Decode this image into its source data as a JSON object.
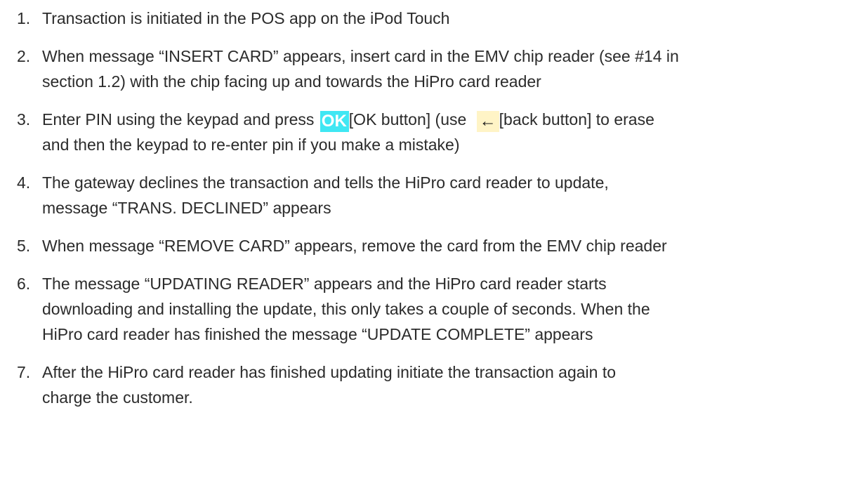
{
  "steps": [
    {
      "number": "1.",
      "text": "Transaction is initiated in the POS app on the iPod Touch"
    },
    {
      "number": "2.",
      "line1": "When message “INSERT CARD” appears, insert card in the EMV chip reader (see #14 in",
      "line2": "section 1.2)  with the chip facing up and towards the HiPro card reader"
    },
    {
      "number": "3.",
      "prefix": "Enter PIN using the keypad and press",
      "ok_glyph": "OK",
      "mid": "[OK button] (use",
      "back_glyph": "←",
      "suffix": "[back button] to erase",
      "line2": "and then the keypad to re-enter pin if you make a mistake)"
    },
    {
      "number": "4.",
      "line1": "The gateway declines the transaction and tells the HiPro card reader to update,",
      "line2": "message “TRANS. DECLINED” appears"
    },
    {
      "number": "5.",
      "text": "When message “REMOVE CARD” appears, remove the card from the EMV chip reader"
    },
    {
      "number": "6.",
      "line1": "The message “UPDATING READER” appears and the HiPro card reader starts",
      "line2": "downloading and installing the update, this only takes a couple of seconds. When the",
      "line3": "HiPro card reader has finished the message “UPDATE COMPLETE” appears"
    },
    {
      "number": "7.",
      "line1": "After the HiPro card reader has finished updating initiate the transaction again to",
      "line2": "charge the customer."
    }
  ],
  "icons": {
    "ok": "ok-button-icon",
    "back": "back-arrow-icon"
  },
  "colors": {
    "ok_background": "#3fe7f3",
    "back_background": "#fff4c6",
    "text": "#2b2b2b"
  }
}
